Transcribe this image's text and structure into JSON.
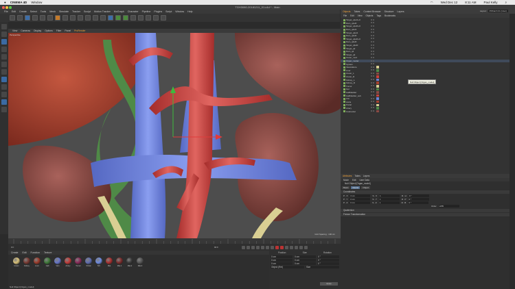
{
  "mac_menu": {
    "apple": "",
    "app": "CINEMA 4D",
    "window": "Window"
  },
  "mac_status": {
    "date": "Wed Dec 12",
    "time": "8:11 AM",
    "user": "Paul Kelly"
  },
  "title": "TGH3080-20181211_01.c4d * - Main",
  "menubar": [
    "File",
    "Edit",
    "Create",
    "Select",
    "Tools",
    "Mesh",
    "Simulate",
    "Tracker",
    "Sculpt",
    "Motion Tracker",
    "MoGraph",
    "Character",
    "Pipeline",
    "Plugins",
    "Script",
    "Window",
    "Help"
  ],
  "viewport_menu": [
    "View",
    "Cameras",
    "Display",
    "Options",
    "Filter",
    "Panel",
    "ProRender"
  ],
  "viewport_menu_active": "ProRender",
  "viewport_label": "Perspective",
  "grid_info": "Grid Spacing : 100 cm",
  "layout": {
    "label": "Layout:",
    "value": "PRKarch 01 (User)"
  },
  "object_tabs": [
    "Objects",
    "Takes",
    "Content Browser",
    "Structure",
    "Layers"
  ],
  "object_menu": [
    "File",
    "Edit",
    "View",
    "Objects",
    "Tags",
    "Bookmarks"
  ],
  "objects": [
    "Target_q1el1+0",
    "Dam_q1el0",
    "Target_q1el0+0",
    "Dam_q2el1",
    "Target_q2el1",
    "Dam_q2el0",
    "Target_q2el0+0",
    "Dam_q3el0",
    "Target_q3el0",
    "Target_q4",
    "Dam_q4",
    "Target_q4",
    "Ureter_mod",
    "Organ_model",
    "System",
    "Vasculature",
    "Liver",
    "Ureter_L",
    "Ureter_R",
    "Kidney_L",
    "Kidney_R",
    "Tumor",
    "Gut",
    "Gallbladder",
    "Gallbladder_sub",
    "IVC",
    "Aorta",
    "Portal",
    "Artery",
    "Colorectal"
  ],
  "selected_object_index": 13,
  "tooltip": "Null Object [Organ_model]",
  "attr_tabs": [
    "Attributes",
    "Takes",
    "Layers"
  ],
  "attr_menu": [
    "Mode",
    "Edit",
    "User Data"
  ],
  "attr_title": "Null Object [Organ_model]",
  "attr_subtabs": [
    "Basic",
    "Coord.",
    "Object"
  ],
  "attr_active_subtab": "Coord.",
  "coordinates_label": "Coordinates",
  "coord_rows": [
    {
      "a": "P . X",
      "av": "0 cm",
      "b": "S . X",
      "bv": "1",
      "c": "R . H",
      "cv": "0 °"
    },
    {
      "a": "P . Y",
      "av": "0 cm",
      "b": "S . Y",
      "bv": "1",
      "c": "R . P",
      "cv": "0 °"
    },
    {
      "a": "P . Z",
      "av": "0 cm",
      "b": "S . Z",
      "bv": "1",
      "c": "R . B",
      "cv": "0 °"
    }
  ],
  "order": {
    "label": "Order",
    "value": "HPB"
  },
  "quaternion_label": "Quaternion",
  "freeze_label": "Freeze Transformation",
  "material_menu": [
    "Create",
    "Edit",
    "Function",
    "Texture"
  ],
  "materials": [
    {
      "name": "Ureter",
      "color": "#d8c17a"
    },
    {
      "name": "Kidney",
      "color": "#7a3b33"
    },
    {
      "name": "Liver",
      "color": "#9b3b2b"
    },
    {
      "name": "Gall",
      "color": "#3f7a3a"
    },
    {
      "name": "Vein",
      "color": "#6676c8"
    },
    {
      "name": "Artery",
      "color": "#c23c3a"
    },
    {
      "name": "Tumor",
      "color": "#8a2b5a"
    },
    {
      "name": "Portal",
      "color": "#5f6db0"
    },
    {
      "name": "IVC",
      "color": "#6f8be0"
    },
    {
      "name": "Mat",
      "color": "#aa3030"
    },
    {
      "name": "Mat.1",
      "color": "#7d2d2d"
    },
    {
      "name": "Mat.2",
      "color": "#3a3a3a"
    },
    {
      "name": "Mat.3",
      "color": "#555555"
    }
  ],
  "coord_panel_headers": [
    "Position",
    "Size",
    "Rotation"
  ],
  "coord_panel_rows": [
    {
      "p": "0 cm",
      "s": "0 cm",
      "r": "0 °"
    },
    {
      "p": "0 cm",
      "s": "0 cm",
      "r": "0 °"
    },
    {
      "p": "0 cm",
      "s": "0 cm",
      "r": "0 °"
    }
  ],
  "coord_mode": "Object (Rel)",
  "coord_size": "Size",
  "apply_label": "Apply",
  "timeline_frame": "0 F",
  "end_frame": "90 F",
  "status_bar": "Null Object [Organ_model]",
  "colors": {
    "artery": "#c9413b",
    "vein": "#6d83d6",
    "liver": "#a9412f",
    "kidney": "#8a4a43",
    "gall": "#4f8a47",
    "ureter": "#d9cf93"
  }
}
